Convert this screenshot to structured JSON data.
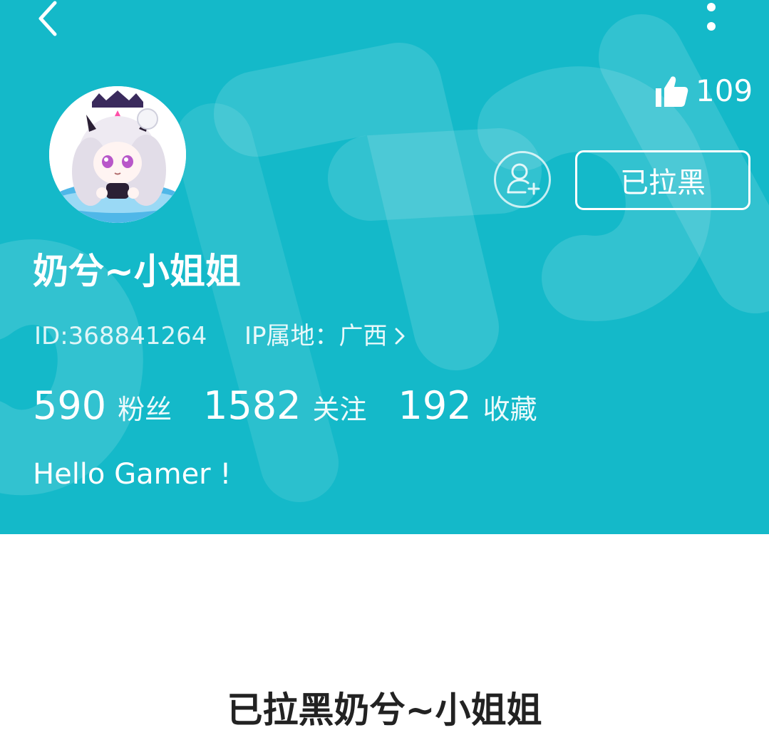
{
  "header": {
    "back_icon": "chevron-left-icon",
    "more_icon": "more-vertical-icon",
    "likes": {
      "icon": "thumbs-up-icon",
      "count": "109"
    },
    "bg_color": "#14b9c9"
  },
  "profile": {
    "name": "奶兮~小姐姐",
    "id_text": "ID:368841264",
    "ip_location": "IP属地：广西",
    "bio": "Hello Gamer !"
  },
  "actions": {
    "follow_icon": "add-user-icon",
    "blocked_label": "已拉黑"
  },
  "stats": [
    {
      "value": "590",
      "label": "粉丝"
    },
    {
      "value": "1582",
      "label": "关注"
    },
    {
      "value": "192",
      "label": "收藏"
    }
  ],
  "body": {
    "blocked_message": "已拉黑奶兮~小姐姐"
  }
}
